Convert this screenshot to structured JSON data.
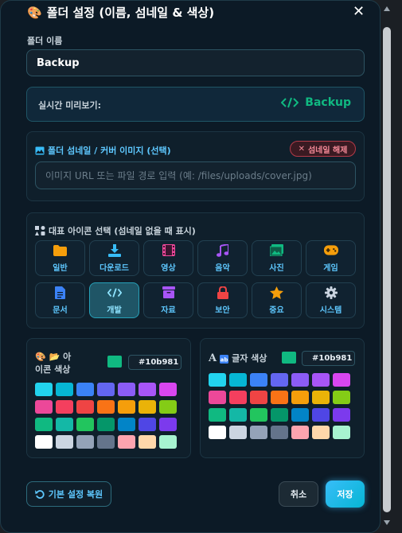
{
  "dialog": {
    "title": "폴더 설정 (이름, 섬네일 & 색상)",
    "close_label": "✕"
  },
  "folder_name": {
    "label": "폴더 이름",
    "value": "Backup"
  },
  "preview": {
    "label": "실시간 미리보기:",
    "value": "Backup",
    "color": "#10b981"
  },
  "thumbnail": {
    "title": "폴더 섬네일 / 커버 이미지 (선택)",
    "remove_label": "섬네일 해제",
    "url_placeholder": "이미지 URL 또는 파일 경로 입력 (예: /files/uploads/cover.jpg)",
    "url_value": ""
  },
  "icon_select": {
    "title": "대표 아이콘 선택 (섬네일 없을 때 표시)",
    "selected": "개발",
    "items": [
      {
        "label": "일반",
        "icon": "folder-icon",
        "color": "#f59e0b"
      },
      {
        "label": "다운로드",
        "icon": "download-icon",
        "color": "#38bdf8"
      },
      {
        "label": "영상",
        "icon": "film-icon",
        "color": "#ec4899"
      },
      {
        "label": "음악",
        "icon": "music-icon",
        "color": "#a855f7"
      },
      {
        "label": "사진",
        "icon": "image-icon",
        "color": "#10b981"
      },
      {
        "label": "게임",
        "icon": "gamepad-icon",
        "color": "#f59e0b"
      },
      {
        "label": "문서",
        "icon": "document-icon",
        "color": "#3b82f6"
      },
      {
        "label": "개발",
        "icon": "code-icon",
        "color": "#8fe4ff"
      },
      {
        "label": "자료",
        "icon": "archive-icon",
        "color": "#a855f7"
      },
      {
        "label": "보안",
        "icon": "lock-icon",
        "color": "#ef4444"
      },
      {
        "label": "중요",
        "icon": "star-icon",
        "color": "#f59e0b"
      },
      {
        "label": "시스템",
        "icon": "gear-icon",
        "color": "#cbd5e1"
      }
    ]
  },
  "icon_color": {
    "title": "아이콘 색상",
    "hex": "#10b981",
    "swatches": [
      "#22d3ee",
      "#06b6d4",
      "#3b82f6",
      "#6366f1",
      "#8b5cf6",
      "#a855f7",
      "#d946ef",
      "#ec4899",
      "#f43f5e",
      "#ef4444",
      "#f97316",
      "#f59e0b",
      "#eab308",
      "#84cc16",
      "#10b981",
      "#14b8a6",
      "#22c55e",
      "#059669",
      "#0284c7",
      "#4f46e5",
      "#7c3aed",
      "#ffffff",
      "#cbd5e1",
      "#94a3b8",
      "#64748b",
      "#fda4af",
      "#fed7aa",
      "#a7f3d0"
    ]
  },
  "text_color": {
    "title": "글자 색상",
    "hex": "#10b981",
    "swatches": [
      "#22d3ee",
      "#06b6d4",
      "#3b82f6",
      "#6366f1",
      "#8b5cf6",
      "#a855f7",
      "#d946ef",
      "#ec4899",
      "#f43f5e",
      "#ef4444",
      "#f97316",
      "#f59e0b",
      "#eab308",
      "#84cc16",
      "#10b981",
      "#14b8a6",
      "#22c55e",
      "#059669",
      "#0284c7",
      "#4f46e5",
      "#7c3aed",
      "#ffffff",
      "#cbd5e1",
      "#94a3b8",
      "#64748b",
      "#fda4af",
      "#fed7aa",
      "#a7f3d0"
    ]
  },
  "footer": {
    "reset_label": "기본 설정 복원",
    "cancel_label": "취소",
    "save_label": "저장"
  }
}
